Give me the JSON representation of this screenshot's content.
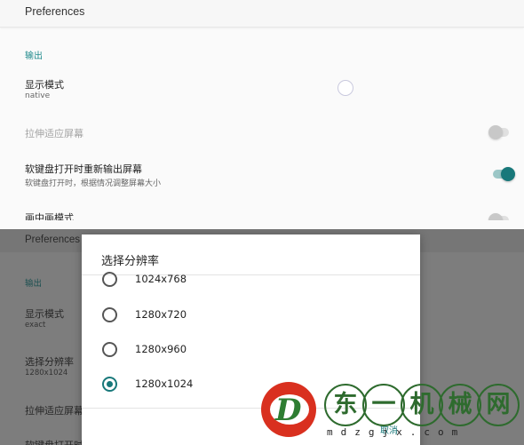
{
  "top": {
    "app_title": "Preferences",
    "section": "输出",
    "display_mode": {
      "title": "显示模式",
      "value": "native"
    },
    "stretch": {
      "title": "拉伸适应屏幕",
      "enabled": false
    },
    "keyboard": {
      "title": "软键盘打开时重新输出屏幕",
      "summary": "软键盘打开时，根据情况调整屏幕大小",
      "enabled": true
    },
    "pip": {
      "title": "画中画模式"
    }
  },
  "bottom": {
    "app_title": "Preferences",
    "section": "输出",
    "display_mode": {
      "title": "显示模式",
      "value": "exact"
    },
    "resolution": {
      "title": "选择分辨率",
      "value": "1280x1024"
    },
    "stretch": {
      "title": "拉伸适应屏幕"
    },
    "keyboard": {
      "title": "软键盘打开时"
    }
  },
  "dialog": {
    "title": "选择分辨率",
    "options": [
      {
        "label": "1024x768",
        "checked": false
      },
      {
        "label": "1280x720",
        "checked": false
      },
      {
        "label": "1280x960",
        "checked": false
      },
      {
        "label": "1280x1024",
        "checked": true
      }
    ],
    "cancel": "取消"
  },
  "watermark": {
    "chars": [
      "东",
      "一",
      "机",
      "械",
      "网"
    ],
    "url": "mdzgjx.com"
  },
  "colors": {
    "accent": "#18787a",
    "section": "#1f8a8c",
    "watermark_red": "#d9301f",
    "watermark_green": "#2e6b2e"
  }
}
